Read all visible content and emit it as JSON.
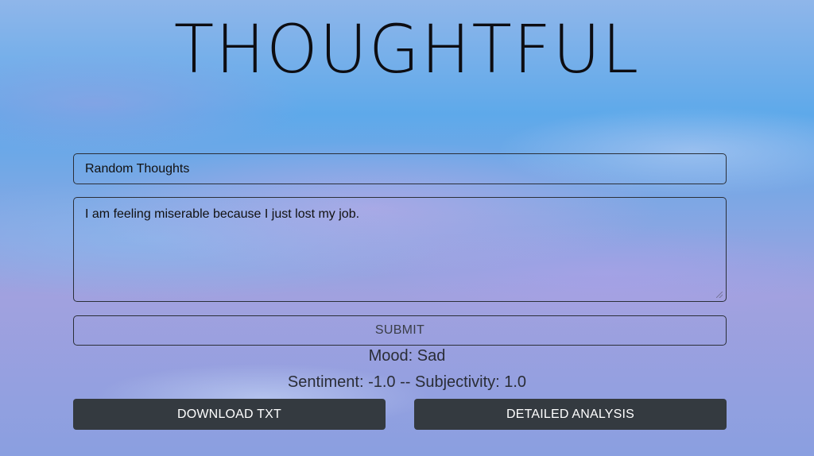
{
  "header": {
    "title": "THOUGHTFUL"
  },
  "form": {
    "title_value": "Random Thoughts",
    "body_value": "I am feeling miserable because I just lost my job.",
    "submit_label": "SUBMIT"
  },
  "result": {
    "mood_text": "Mood: Sad",
    "scores_text": "Sentiment: -1.0 -- Subjectivity: 1.0"
  },
  "actions": {
    "download_label": "DOWNLOAD TXT",
    "analysis_label": "DETAILED ANALYSIS"
  },
  "colors": {
    "button_dark": "#343a40",
    "border": "#2b2f38",
    "title_text": "#0d0d12"
  }
}
